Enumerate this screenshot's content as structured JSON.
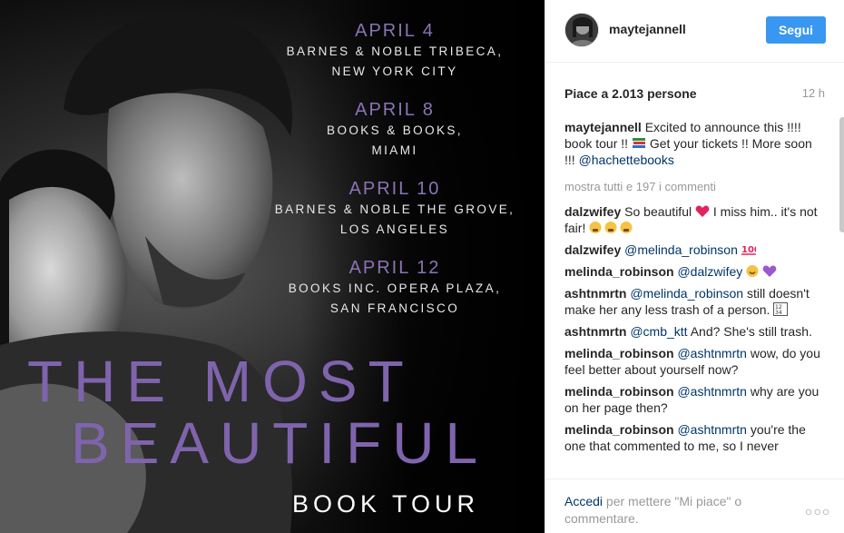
{
  "poster": {
    "events": [
      {
        "date": "APRIL 4",
        "line1": "BARNES & NOBLE TRIBECA,",
        "line2": "NEW YORK CITY"
      },
      {
        "date": "APRIL 8",
        "line1": "BOOKS & BOOKS,",
        "line2": "MIAMI"
      },
      {
        "date": "APRIL 10",
        "line1": "BARNES & NOBLE THE GROVE,",
        "line2": "LOS ANGELES"
      },
      {
        "date": "APRIL 12",
        "line1": "BOOKS INC. OPERA PLAZA,",
        "line2": "SAN FRANCISCO"
      }
    ],
    "title_line1": "THE MOST",
    "title_line2": "BEAUTIFUL",
    "subtitle": "BOOK TOUR",
    "colors": {
      "accent": "#7f64ad"
    }
  },
  "header": {
    "username": "maytejannell",
    "follow_label": "Segui",
    "follow_color": "#3897f0"
  },
  "stats": {
    "likes": "Piace a 2.013 persone",
    "time": "12 h"
  },
  "caption": {
    "user": "maytejannell",
    "text_before": " Excited to announce this !!!! book tour !! ",
    "emoji": "books-emoji",
    "text_after": " Get your tickets !! More soon !!! ",
    "mention": "@hachettebooks"
  },
  "more_comments": "mostra tutti e 197 i commenti",
  "comments": [
    {
      "user": "dalzwifey",
      "text": " So beautiful ",
      "emoji": "heart-emoji",
      "text2": " I miss him.. it's not fair! ",
      "emoji2": "weary-faces-emoji"
    },
    {
      "user": "dalzwifey",
      "mention": "@melinda_robinson",
      "emoji": "hundred-points-emoji"
    },
    {
      "user": "melinda_robinson",
      "mention": "@dalzwifey",
      "emoji": "smile-purple-heart-emoji"
    },
    {
      "user": "ashtnmrtn",
      "mention": "@melinda_robinson",
      "text": " still doesn't make her any less trash of a person. ",
      "emoji": "one-two-three-four-emoji"
    },
    {
      "user": "ashtnmrtn",
      "mention": "@cmb_ktt",
      "text": " And? She's still trash."
    },
    {
      "user": "melinda_robinson",
      "mention": "@ashtnmrtn",
      "text": " wow, do you feel better about yourself now?"
    },
    {
      "user": "melinda_robinson",
      "mention": "@ashtnmrtn",
      "text": " why are you on her page then?"
    },
    {
      "user": "melinda_robinson",
      "mention": "@ashtnmrtn",
      "text": " you're the one that commented to me, so I never"
    }
  ],
  "footer": {
    "login_link": "Accedi",
    "login_text": " per mettere \"Mi piace\" o commentare.",
    "more_icon": "ellipsis-icon"
  }
}
